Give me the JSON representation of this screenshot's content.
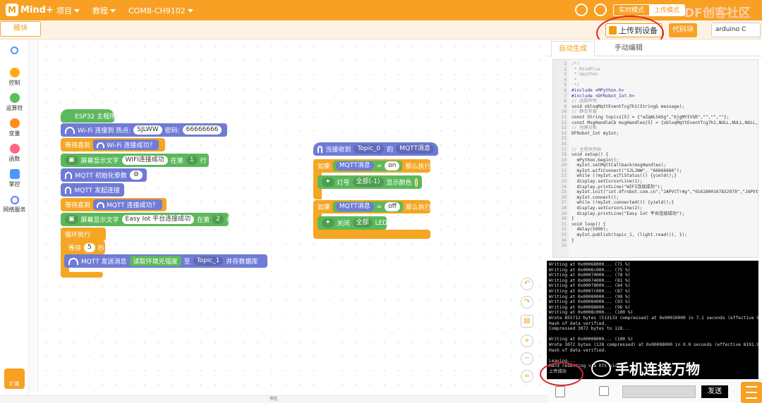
{
  "app": {
    "logo": "Mind+"
  },
  "menu": [
    {
      "label": "项目"
    },
    {
      "label": "教程"
    },
    {
      "label": "COM8-CH9102"
    }
  ],
  "mode": {
    "realtime": "实时模式",
    "upload": "上传模式"
  },
  "watermark_top": "DF创客社区",
  "toolbar": {
    "blocks_tab": "模块",
    "upload_button": "上传到设备",
    "code_button": "代码块",
    "board": "arduino C"
  },
  "categories": [
    {
      "label": "",
      "color": "#4c97ff",
      "icon": "search-icon"
    },
    {
      "label": "控制",
      "color": "#ffab19"
    },
    {
      "label": "运算符",
      "color": "#59c059"
    },
    {
      "label": "变量",
      "color": "#ff8c1a"
    },
    {
      "label": "函数",
      "color": "#ff6680"
    },
    {
      "label": "掌控",
      "color": "#4c97ff"
    },
    {
      "label": "网络服务",
      "color": "#5c7cfa"
    }
  ],
  "extension": {
    "label": "扩展"
  },
  "blocks": {
    "hat1": "ESP32 主程序",
    "wifi_connect": {
      "label": "Wi-Fi 连接到 热点:",
      "ssid": "SJLWW",
      "pwd_label": "密码:",
      "pwd": "66666666"
    },
    "wait1": {
      "label": "等待直到",
      "inner": "Wi-Fi 连接成功？"
    },
    "screen1": {
      "label": "屏幕显示文字",
      "text": "WIFI连接成功",
      "pos": "在第",
      "line": "1",
      "unit": "行"
    },
    "mqtt_init": "MQTT 初始化参数",
    "mqtt_start": "MQTT 发起连接",
    "wait2": {
      "label": "等待直到",
      "inner": "MQTT 连接成功？"
    },
    "screen2": {
      "label": "屏幕显示文字",
      "text": "Easy Iot 平台连接成功",
      "pos": "在第",
      "line": "2",
      "unit": "行"
    },
    "loop": "循环执行",
    "wait3": {
      "label": "等待",
      "value": "5",
      "unit": "秒"
    },
    "mqtt_send": {
      "label": "MQTT 发送消息",
      "sensor": "读取环境光强度",
      "to": "至",
      "topic": "Topic_1",
      "save": "并存数据库"
    },
    "hat2": {
      "label": "当接收到",
      "topic": "Topic_0",
      "suffix": "的",
      "msg": "MQTT消息"
    },
    "if1": {
      "label": "如果",
      "cond": "MQTT消息",
      "eq": "=",
      "val": "on",
      "then": "那么执行"
    },
    "light_on": {
      "label": "灯号",
      "which": "全部(-1)",
      "action": "显示颜色"
    },
    "if2": {
      "label": "如果",
      "cond": "MQTT消息",
      "eq": "=",
      "val": "off",
      "then": "那么执行"
    },
    "light_off": {
      "label": "关闭",
      "which": "全部",
      "target": "LED"
    }
  },
  "right_panel": {
    "tab_auto": "自动生成",
    "tab_manual": "手动编辑",
    "line_numbers": [
      "1",
      "2",
      "3",
      "4",
      "5",
      "6",
      "7",
      "8",
      "9",
      "10",
      "11",
      "12",
      "13",
      "14",
      "15",
      "16",
      "17",
      "18",
      "19",
      "20",
      "21",
      "22",
      "23",
      "24",
      "25",
      "26",
      "27",
      "28",
      "29",
      "30",
      "31",
      "32",
      "33",
      "34",
      "35"
    ],
    "code": [
      "/*!",
      " * MindPlus",
      " * mpython",
      " *",
      " */",
      "#include <MPython.h>",
      "#include <DFRobot_Iot.h>",
      "// 函数声明",
      "void obloqMqttEventTcg7h1(String& message);",
      "// 静态常量",
      "const String topics[5] = {\"wZqWLS4Sg\",\"bjgMYIVSR\",\"\",\"\",\"\"};",
      "const MsgHandleCb msgHandles[5] = {obloqMqttEventTcg7h1,NULL,NULL,NULL,NULL};",
      "// 创建对象",
      "DFRobot_Iot myIot;",
      "",
      "",
      "// 主程序开始",
      "void setup() {",
      "  mPython.begin();",
      "  myIot.setMqttCallback(msgHandles);",
      "  myIot.wifiConnect(\"SJLJWW\", \"66666666\");",
      "  while (!myIot.wifiStatus()) {yield();}",
      "  display.setCursorLine(1);",
      "  display.printLine(\"WIFI连接成功\");",
      "  myIot.init(\"iot.dfrobot.com.cn\",\"JAPVtTr4g\",\"0162800167832979\",\"JAPVtTr4g\",topics,1883);",
      "  myIot.connect();",
      "  while (!myIot.connected()) {yield();}",
      "  display.setCursorLine(2);",
      "  display.printLine(\"Easy Iot 平台连接成功\");",
      "}",
      "void loop() {",
      "  delay(5000);",
      "  myIot.publish(topic_1, (light.read()), 1);",
      "}",
      ""
    ],
    "console": [
      "Writing at 0x00068000... (71 %)",
      "Writing at 0x0006c000... (75 %)",
      "Writing at 0x00070000... (78 %)",
      "Writing at 0x00074000... (81 %)",
      "Writing at 0x00078000... (84 %)",
      "Writing at 0x0007c000... (87 %)",
      "Writing at 0x00080000... (90 %)",
      "Writing at 0x00084000... (93 %)",
      "Writing at 0x00088000... (96 %)",
      "Writing at 0x0008c000... (100 %)",
      "Wrote 855712 bytes (513133 compressed) at 0x00010000 in 7.1 seconds (effective 964.1 kbit/s)...",
      "Hash of data verified.",
      "Compressed 3072 bytes to 128...",
      "",
      "Writing at 0x00008000... (100 %)",
      "Wrote 3072 bytes (128 compressed) at 0x00008000 in 0.0 seconds (effective 8191.9 kbit/s)...",
      "Hash of data verified.",
      "",
      "Leaving...",
      "Hard resetting via RTS pin...",
      "上传成功"
    ],
    "send_button": "发送"
  },
  "overlay_text": "手机连接万物",
  "status": {
    "label": "书包"
  },
  "colors": {
    "accent": "#f7a024",
    "annotation": "#d8262a"
  }
}
